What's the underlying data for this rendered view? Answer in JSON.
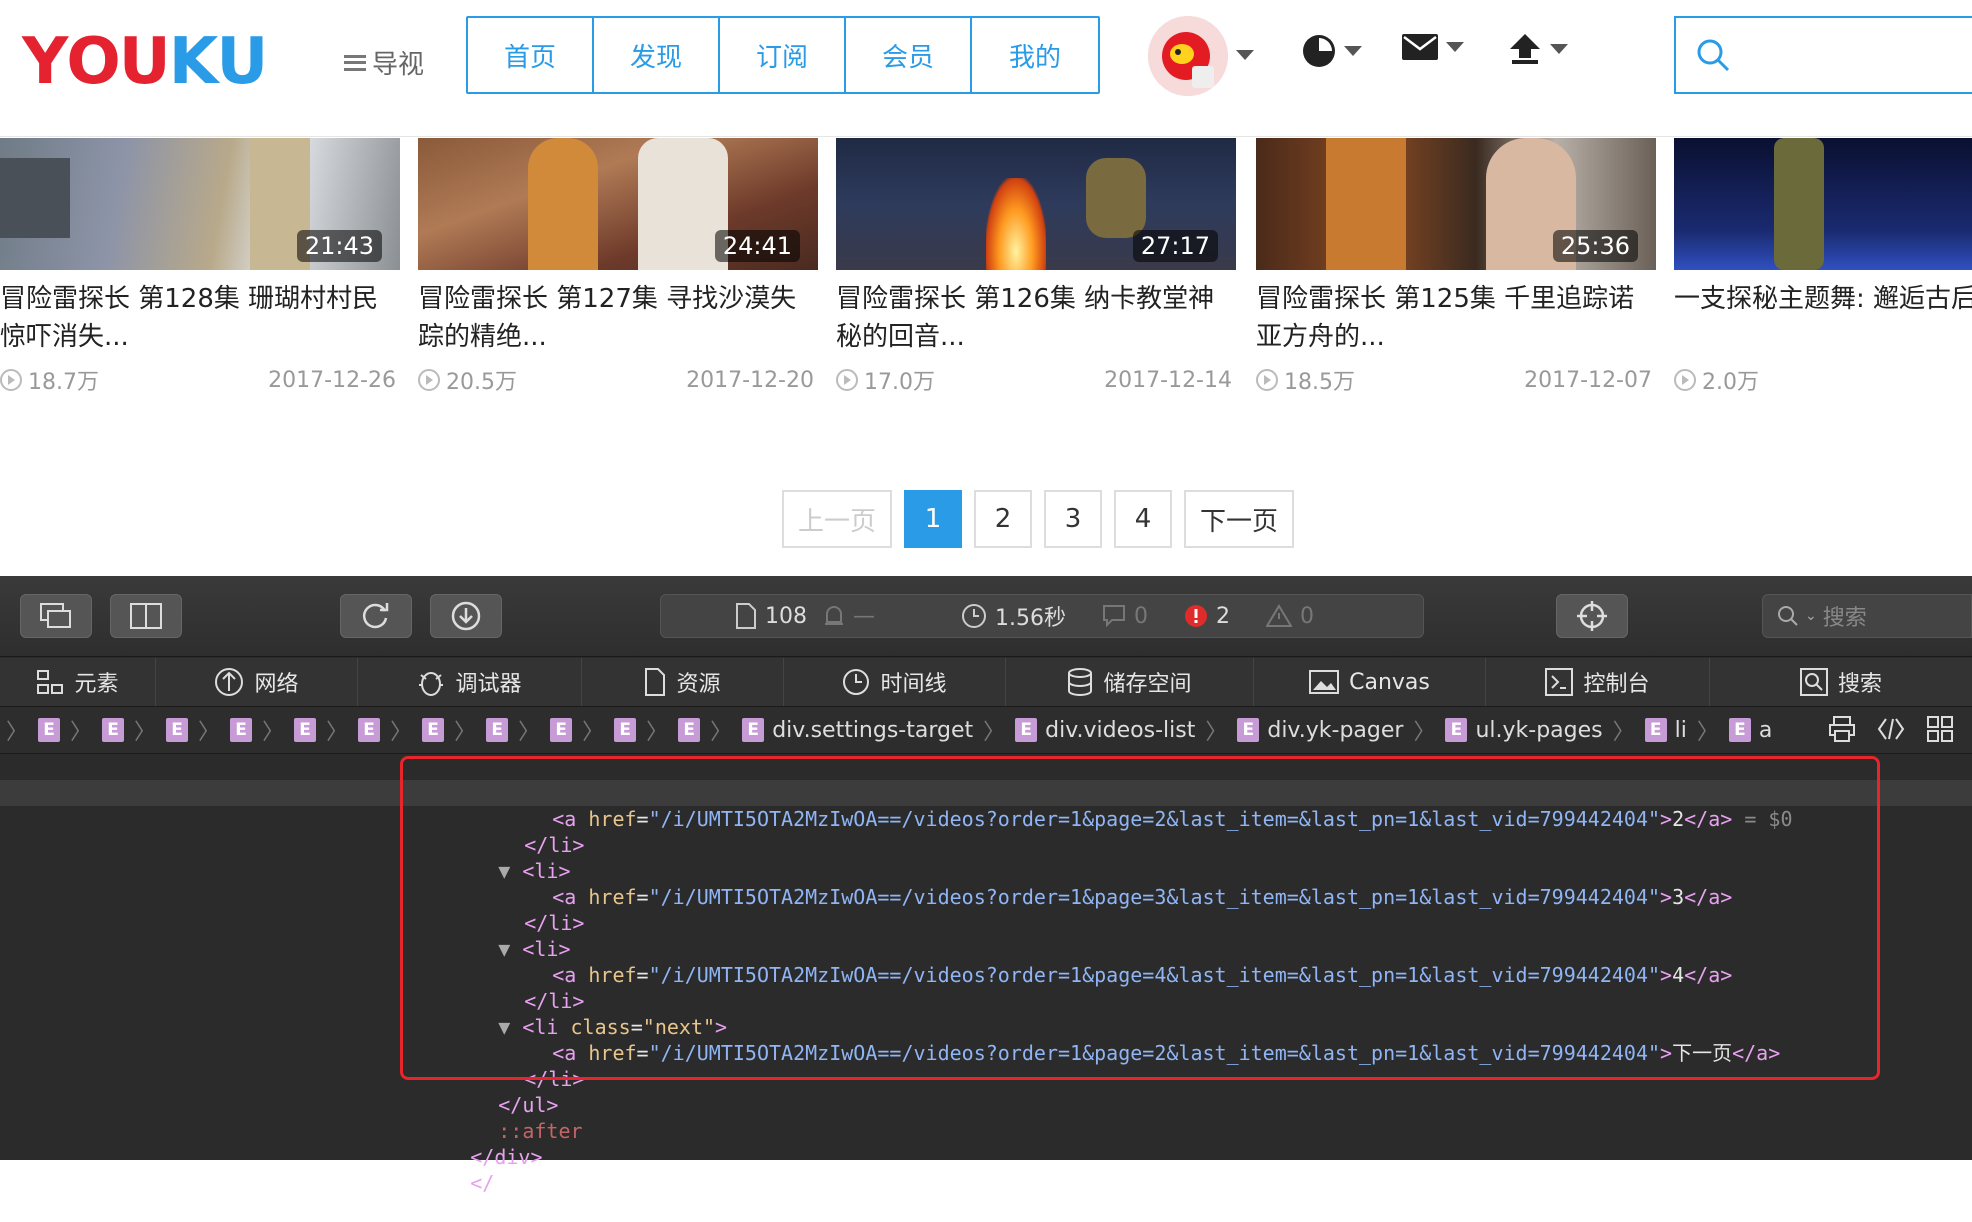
{
  "header": {
    "logo": {
      "text": "YOUKU",
      "colors": [
        "#e5222f",
        "#e5222f",
        "#e5222f",
        "#2a9be6",
        "#2a9be6"
      ]
    },
    "menu_label": "导视",
    "nav": [
      "首页",
      "发现",
      "订阅",
      "会员",
      "我的"
    ],
    "accent_color": "#2a9be6",
    "icons": [
      "avatar",
      "clock-icon",
      "mail-icon",
      "upload-icon",
      "search-icon"
    ]
  },
  "videos": [
    {
      "title": "冒险雷探长 第128集 珊瑚村村民惊吓消失...",
      "duration": "21:43",
      "views": "18.7万",
      "date": "2017-12-26"
    },
    {
      "title": "冒险雷探长 第127集 寻找沙漠失踪的精绝...",
      "duration": "24:41",
      "views": "20.5万",
      "date": "2017-12-20"
    },
    {
      "title": "冒险雷探长 第126集 纳卡教堂神秘的回音...",
      "duration": "27:17",
      "views": "17.0万",
      "date": "2017-12-14"
    },
    {
      "title": "冒险雷探长 第125集 千里追踪诺亚方舟的...",
      "duration": "25:36",
      "views": "18.5万",
      "date": "2017-12-07"
    },
    {
      "title": "一支探秘主题舞: 邂逅古后, 雷探...",
      "duration": "",
      "views": "2.0万",
      "date": ""
    }
  ],
  "pager": {
    "prev": "上一页",
    "pages": [
      "1",
      "2",
      "3",
      "4"
    ],
    "current": "1",
    "next": "下一页",
    "active_color": "#2a9be6"
  },
  "devtools": {
    "status": {
      "resources": "108",
      "requests": "—",
      "load_time": "1.56秒",
      "logs": "0",
      "errors": "2",
      "warnings": "0"
    },
    "search_placeholder": "搜索",
    "tabs": [
      "元素",
      "网络",
      "调试器",
      "资源",
      "时间线",
      "储存空间",
      "Canvas",
      "控制台",
      "搜索"
    ],
    "breadcrumb_badge": "E",
    "breadcrumb": [
      "div.settings-target",
      "div.videos-list",
      "div.yk-pager",
      "ul.yk-pages",
      "li",
      "a"
    ],
    "code": {
      "li_open": "<li>",
      "li_close": "</li>",
      "li_next_tag": "<li ",
      "class_attr": "class",
      "class_val": "\"next\"",
      "a_open": "<a ",
      "href_attr": "href",
      "eq": "=",
      "href2": "\"/i/UMTI5OTA2MzIwOA==/videos?order=1&page=2&last_item=&last_pn=1&last_vid=799442404\"",
      "href3": "\"/i/UMTI5OTA2MzIwOA==/videos?order=1&page=3&last_item=&last_pn=1&last_vid=799442404\"",
      "href4": "\"/i/UMTI5OTA2MzIwOA==/videos?order=1&page=4&last_item=&last_pn=1&last_vid=799442404\"",
      "hrefnext": "\"/i/UMTI5OTA2MzIwOA==/videos?order=1&page=2&last_item=&last_pn=1&last_vid=799442404\"",
      "gt": ">",
      "a_close": "</a>",
      "text2": "2",
      "text3": "3",
      "text4": "4",
      "textnext": "下一页",
      "sel_marker": " = $0",
      "ul_close": "</ul>",
      "after": "::after",
      "div_close": "</div>",
      "more": "</"
    }
  }
}
